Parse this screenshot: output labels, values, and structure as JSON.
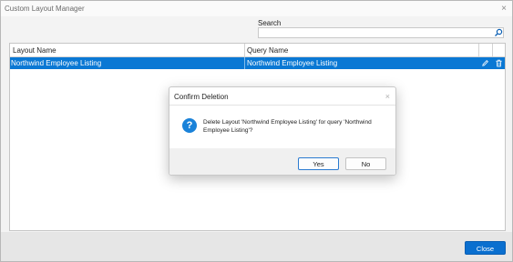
{
  "window": {
    "title": "Custom Layout Manager",
    "close_glyph": "×"
  },
  "search": {
    "label": "Search",
    "value": "",
    "icon": "search-icon"
  },
  "grid": {
    "columns": [
      "Layout Name",
      "Query Name"
    ],
    "rows": [
      {
        "layout_name": "Northwind Employee Listing",
        "query_name": "Northwind Employee Listing",
        "selected": true,
        "actions": [
          "edit-icon",
          "delete-icon"
        ]
      }
    ]
  },
  "footer": {
    "close_label": "Close"
  },
  "dialog": {
    "title": "Confirm Deletion",
    "close_glyph": "×",
    "icon": "question-icon",
    "icon_glyph": "?",
    "message": "Delete Layout 'Northwind Employee Listing' for query 'Northwind Employee Listing'?",
    "yes_label": "Yes",
    "no_label": "No"
  },
  "colors": {
    "accent": "#0a78d4",
    "primary_button": "#0a6fcf"
  }
}
